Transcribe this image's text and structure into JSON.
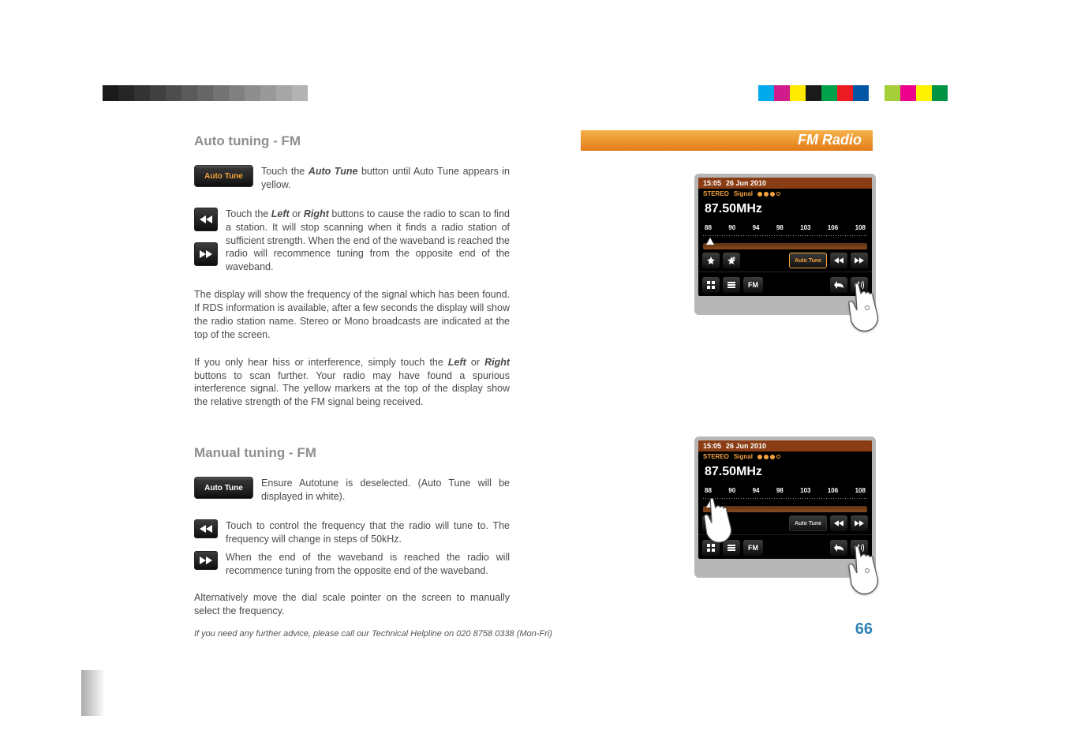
{
  "header": {
    "title": "FM Radio"
  },
  "section1": {
    "title": "Auto tuning - FM",
    "btn_auto_label": "Auto Tune",
    "p1_pre": "Touch the ",
    "p1_bold": "Auto Tune",
    "p1_post": " button until Auto Tune appears in yellow.",
    "p2_pre": "Touch the ",
    "p2_b1": "Left",
    "p2_mid": " or ",
    "p2_b2": "Right",
    "p2_post": " buttons to cause the radio to scan to find a station. It will stop scanning when it finds a radio station of sufficient strength. When the end of the waveband is reached the radio will recommence tuning from the opposite end of the waveband.",
    "p3": "The display will show the frequency of the signal which has been found. If RDS information is available, after a few seconds the display will show the radio station name. Stereo or Mono broadcasts are indicated at the top of the screen.",
    "p4_pre": "If you only hear hiss or interference, simply touch the ",
    "p4_b1": "Left",
    "p4_mid": " or ",
    "p4_b2": "Right",
    "p4_post": " buttons to scan further. Your radio may have found a spurious interference signal. The yellow markers at the top of the display show the relative strength of the FM signal being received."
  },
  "section2": {
    "title": "Manual tuning - FM",
    "btn_auto_label": "Auto Tune",
    "p1": "Ensure Autotune is deselected. (Auto Tune will be displayed in white).",
    "p2": "Touch to control the frequency that the radio will tune to. The frequency will change in steps of 50kHz.",
    "p3": "When the end of the waveband is reached the radio will recommence tuning from the opposite end of the waveband.",
    "p4": "Alternatively move the dial scale pointer on the screen to manually select the frequency."
  },
  "device": {
    "time": "15:05",
    "date": "26 Jun 2010",
    "stereo_label": "STEREO",
    "signal_label": "Signal",
    "frequency": "87.50MHz",
    "ticks": [
      "88",
      "90",
      "94",
      "98",
      "103",
      "106",
      "108"
    ],
    "auto_tune_label": "Auto Tune",
    "fm_label": "FM"
  },
  "footer": {
    "helpline": "If you need any further advice, please call our Technical Helpline on 020 8758 0338 (Mon-Fri)",
    "page": "66"
  },
  "colorbar_left": [
    "#1a1a1a",
    "#262626",
    "#333333",
    "#404040",
    "#4d4d4d",
    "#5a5a5a",
    "#666666",
    "#737373",
    "#808080",
    "#8d8d8d",
    "#999999",
    "#a6a6a6",
    "#b3b3b3",
    "#ffffff"
  ],
  "colorbar_right": [
    "#00aaea",
    "#d11c8b",
    "#ffea00",
    "#1a1a1a",
    "#00a14b",
    "#ed1c24",
    "#0055a5",
    "#ffffff",
    "#a6ce39",
    "#ec008c",
    "#fff200",
    "#009444",
    "#ffffff"
  ]
}
